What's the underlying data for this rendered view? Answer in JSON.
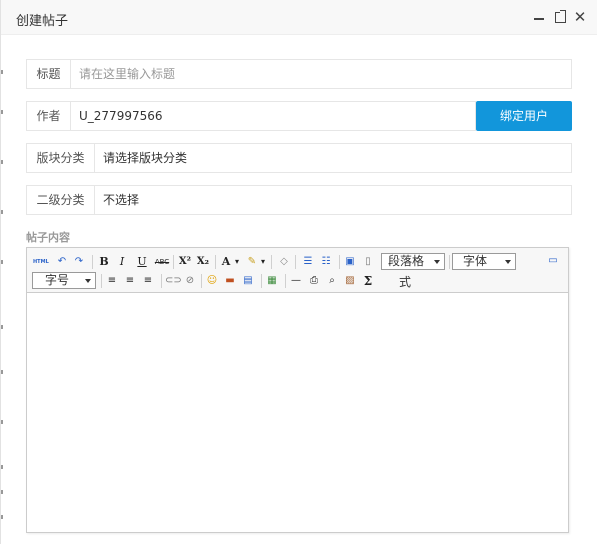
{
  "dialog": {
    "title": "创建帖子",
    "controls": {
      "close_glyph": "✕"
    }
  },
  "form": {
    "title_field": {
      "label": "标题",
      "placeholder": "请在这里输入标题",
      "value": ""
    },
    "author_field": {
      "label": "作者",
      "value": "U_277997566",
      "button_label": "绑定用户"
    },
    "board_field": {
      "label": "版块分类",
      "value": "请选择版块分类"
    },
    "sub_field": {
      "label": "二级分类",
      "value": "不选择"
    },
    "content_label": "帖子内容"
  },
  "editor": {
    "toolbar": {
      "html_label": "HTML",
      "bold": "B",
      "italic": "I",
      "underline": "U",
      "strike": "ABC",
      "superscript": "X²",
      "subscript": "X₂",
      "font_color": "A",
      "sigma": "Σ",
      "paragraph_format": "段落格",
      "paragraph_format_wrap": "式",
      "font_family": "字体",
      "font_size": "字号"
    }
  },
  "colors": {
    "accent": "#1296db",
    "border": "#e6e6e6",
    "titlebar": "#f8f8f8"
  }
}
